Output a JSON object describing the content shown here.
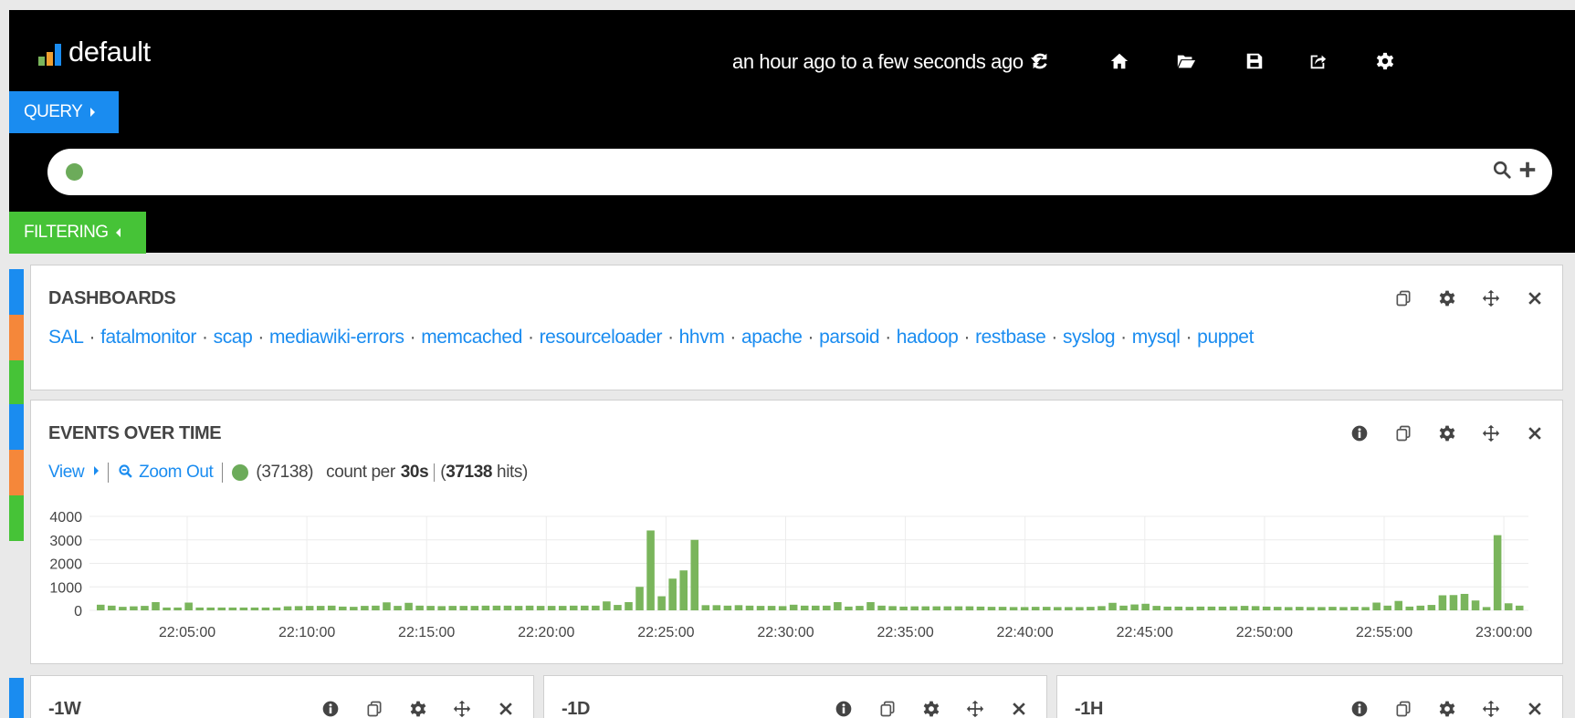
{
  "app": {
    "title": "default",
    "time_range": "an hour ago to a few seconds ago",
    "brand_colors": [
      "#7ab55c",
      "#f0a030",
      "#1a8cf0"
    ]
  },
  "toolbar": {
    "icons": [
      "refresh-icon",
      "home-icon",
      "folder-open-icon",
      "save-icon",
      "share-icon",
      "settings-icon"
    ]
  },
  "query": {
    "button_label": "QUERY",
    "search_value": "",
    "status_color": "#6cab5a"
  },
  "filtering": {
    "button_label": "FILTERING"
  },
  "row_colors": [
    "#1a8cf0",
    "#f5873a",
    "#46c337"
  ],
  "dashboards_panel": {
    "title": "DASHBOARDS",
    "links": [
      "SAL",
      "fatalmonitor",
      "scap",
      "mediawiki-errors",
      "memcached",
      "resourceloader",
      "hhvm",
      "apache",
      "parsoid",
      "hadoop",
      "restbase",
      "syslog",
      "mysql",
      "puppet"
    ],
    "separator": "·"
  },
  "events_panel": {
    "title": "EVENTS OVER TIME",
    "view_label": "View",
    "zoom_out_label": "Zoom Out",
    "legend_count": "(37138)",
    "count_per_prefix": "count per",
    "interval": "30s",
    "hits_open": "(",
    "hits_count": "37138",
    "hits_suffix": "hits)"
  },
  "chart_data": {
    "type": "bar",
    "ylim": [
      0,
      4000
    ],
    "y_ticks": [
      "4000",
      "3000",
      "2000",
      "1000",
      "0"
    ],
    "x_ticks": [
      "22:05:00",
      "22:10:00",
      "22:15:00",
      "22:20:00",
      "22:25:00",
      "22:30:00",
      "22:35:00",
      "22:40:00",
      "22:45:00",
      "22:50:00",
      "22:55:00",
      "23:00:00"
    ],
    "bar_color": "#7ab55c",
    "grid": true,
    "series": [
      {
        "values": [
          240,
          200,
          150,
          170,
          190,
          350,
          120,
          120,
          330,
          120,
          120,
          120,
          120,
          120,
          120,
          120,
          120,
          170,
          180,
          190,
          190,
          200,
          160,
          150,
          190,
          200,
          340,
          190,
          320,
          200,
          190,
          180,
          190,
          190,
          190,
          200,
          200,
          200,
          190,
          200,
          190,
          190,
          190,
          200,
          200,
          200,
          380,
          230,
          350,
          1000,
          3400,
          600,
          1350,
          1700,
          3000,
          220,
          220,
          200,
          220,
          200,
          190,
          190,
          180,
          240,
          200,
          200,
          200,
          350,
          160,
          190,
          350,
          200,
          180,
          160,
          170,
          170,
          170,
          170,
          170,
          170,
          160,
          150,
          150,
          140,
          140,
          150,
          150,
          140,
          140,
          140,
          150,
          180,
          320,
          200,
          250,
          280,
          190,
          160,
          160,
          150,
          160,
          160,
          160,
          170,
          190,
          180,
          160,
          150,
          140,
          150,
          140,
          140,
          150,
          140,
          150,
          140,
          330,
          200,
          400,
          160,
          200,
          230,
          640,
          650,
          700,
          420,
          140,
          3200,
          300,
          200
        ]
      }
    ]
  },
  "bottom_panels": [
    {
      "title": "-1W"
    },
    {
      "title": "-1D"
    },
    {
      "title": "-1H"
    }
  ]
}
